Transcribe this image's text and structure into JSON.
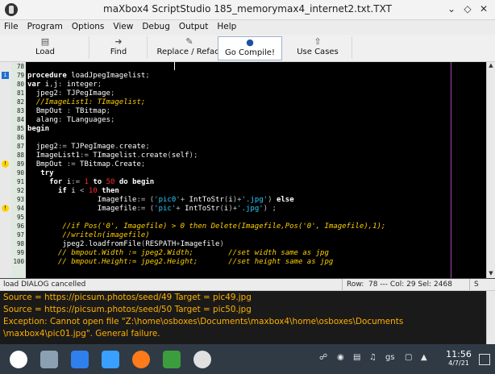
{
  "window": {
    "title": "maXbox4 ScriptStudio 185_memorymax4_internet2.txt.TXT",
    "controls": [
      "chevron-down-icon",
      "restore-icon",
      "close-icon"
    ]
  },
  "menu": [
    "File",
    "Program",
    "Options",
    "View",
    "Debug",
    "Output",
    "Help"
  ],
  "toolbar": [
    {
      "label": "Load",
      "icon": "load-icon"
    },
    {
      "label": "Find",
      "icon": "find-icon"
    },
    {
      "label": "Replace / Refact",
      "icon": "replace-icon"
    },
    {
      "label": "Go Compile!",
      "icon": "compile-icon"
    },
    {
      "label": "Use Cases",
      "icon": "usecases-icon"
    }
  ],
  "editor": {
    "lines": [
      {
        "n": "78",
        "mark": "",
        "text": ""
      },
      {
        "n": "79",
        "mark": "info",
        "text": "procedure loadJpegImagelist;"
      },
      {
        "n": "80",
        "mark": "",
        "text": "var i,j: integer;"
      },
      {
        "n": "81",
        "mark": "",
        "text": "  jpeg2: TJPegImage;"
      },
      {
        "n": "82",
        "mark": "",
        "text": "  //ImageList1: TImagelist;"
      },
      {
        "n": "83",
        "mark": "",
        "text": "  BmpOut : TBitmap;"
      },
      {
        "n": "84",
        "mark": "",
        "text": "  alang: TLanguages;"
      },
      {
        "n": "85",
        "mark": "",
        "text": "begin"
      },
      {
        "n": "86",
        "mark": "",
        "text": ""
      },
      {
        "n": "87",
        "mark": "",
        "text": "  jpeg2:= TJPegImage.create;"
      },
      {
        "n": "88",
        "mark": "",
        "text": "  ImageList1:= TImagelist.create(self);"
      },
      {
        "n": "89",
        "mark": "warn",
        "text": "  BmpOut := TBitmap.Create;"
      },
      {
        "n": "90",
        "mark": "",
        "text": "   try"
      },
      {
        "n": "91",
        "mark": "",
        "text": "     for i:= 1 to 50 do begin"
      },
      {
        "n": "92",
        "mark": "",
        "text": "       if i < 10 then"
      },
      {
        "n": "93",
        "mark": "",
        "text": "                Imagefile:= ('pic0'+ IntToStr(i)+'.jpg') else"
      },
      {
        "n": "94",
        "mark": "warn",
        "text": "                Imagefile:= ('pic'+ IntToStr(i)+'.jpg') ;"
      },
      {
        "n": "95",
        "mark": "",
        "text": ""
      },
      {
        "n": "96",
        "mark": "",
        "text": "        //if Pos('0', Imagefile) > 0 then Delete(Imagefile,Pos('0', Imagefile),1);"
      },
      {
        "n": "97",
        "mark": "",
        "text": "        //writeln(imagefile)"
      },
      {
        "n": "98",
        "mark": "",
        "text": "        jpeg2.loadfromFile(RESPATH+Imagefile)"
      },
      {
        "n": "99",
        "mark": "",
        "text": "       // bmpout.Width := jpeg2.Width;        //set width same as jpg"
      },
      {
        "n": "100",
        "mark": "",
        "text": "       // bmpout.Height:= jpeg2.Height;       //set height same as jpg"
      }
    ]
  },
  "status": {
    "message": "load DIALOG cancelled",
    "row_label": "Row:",
    "position": "78 --- Col: 29 Sel: 2468",
    "mode": "S"
  },
  "output": {
    "lines": [
      "Source = https://picsum.photos/seed/49 Target = pic49.jpg",
      "Source = https://picsum.photos/seed/50 Target = pic50.jpg",
      "Exception: Cannot open file \"Z:\\home\\osboxes\\Documents\\maxbox4\\home\\osboxes\\Documents",
      "\\maxbox4\\pic01.jpg\". General failure."
    ]
  },
  "taskbar": {
    "apps": [
      "kde-launcher-icon",
      "panel-settings-icon",
      "discover-icon",
      "dolphin-icon",
      "firefox-icon",
      "terminal-icon",
      "maxbox-icon"
    ],
    "tray_lang": "gs",
    "clock_time": "11:56",
    "clock_date": "4/7/21"
  },
  "colors": {
    "editor_bg": "#000000",
    "comment": "#ffd000",
    "string": "#2ecbff",
    "number": "#ff2828",
    "output_text": "#ffb000",
    "taskbar_bg": "#2f3a45"
  }
}
